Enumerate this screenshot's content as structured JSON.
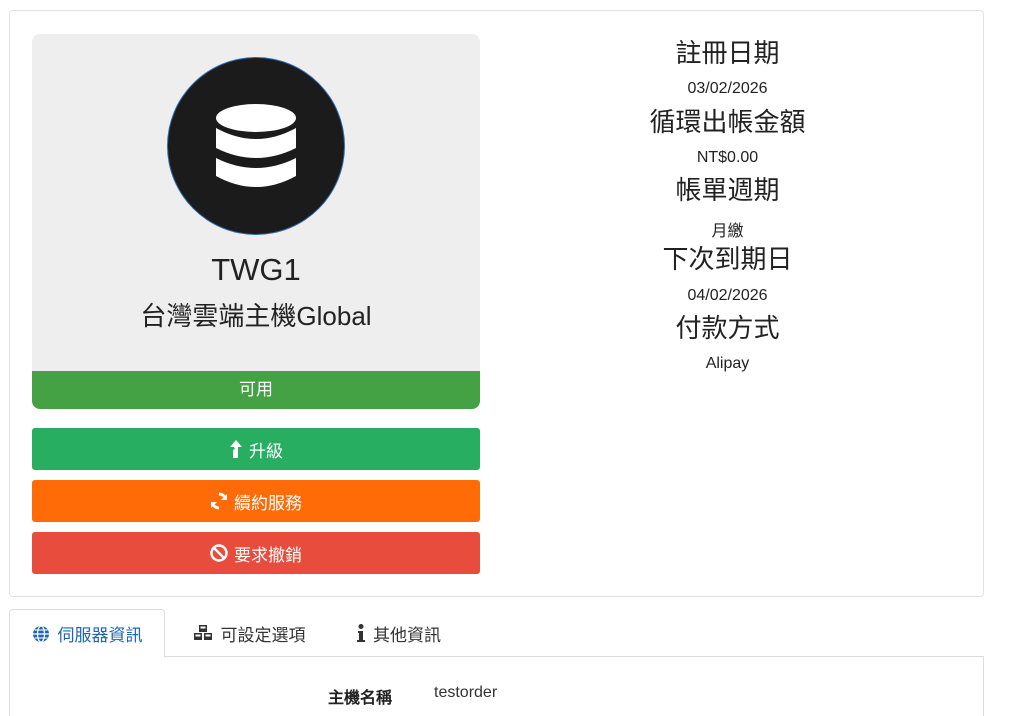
{
  "product": {
    "name": "TWG1",
    "group": "台灣雲端主機Global",
    "status": "可用",
    "icon": "database-icon"
  },
  "actions": {
    "upgrade_label": "升級",
    "renew_label": "續約服務",
    "cancel_label": "要求撤銷"
  },
  "details": [
    {
      "label": "註冊日期",
      "value": "03/02/2026"
    },
    {
      "label": "循環出帳金額",
      "value": "NT$0.00"
    },
    {
      "label": "帳單週期",
      "value": "月繳"
    },
    {
      "label": "下次到期日",
      "value": "04/02/2026"
    },
    {
      "label": "付款方式",
      "value": "Alipay"
    }
  ],
  "tabs": [
    {
      "label": "伺服器資訊",
      "icon": "globe-icon"
    },
    {
      "label": "可設定選項",
      "icon": "cubes-icon"
    },
    {
      "label": "其他資訊",
      "icon": "info-icon"
    }
  ],
  "server_info": {
    "hostname_label": "主機名稱",
    "hostname_value": "testorder"
  },
  "colors": {
    "status_green": "#44a244",
    "upgrade_green": "#27ae60",
    "renew_orange": "#ff6b06",
    "cancel_red": "#e74c3c",
    "tab_active_blue": "#1c64b8"
  }
}
